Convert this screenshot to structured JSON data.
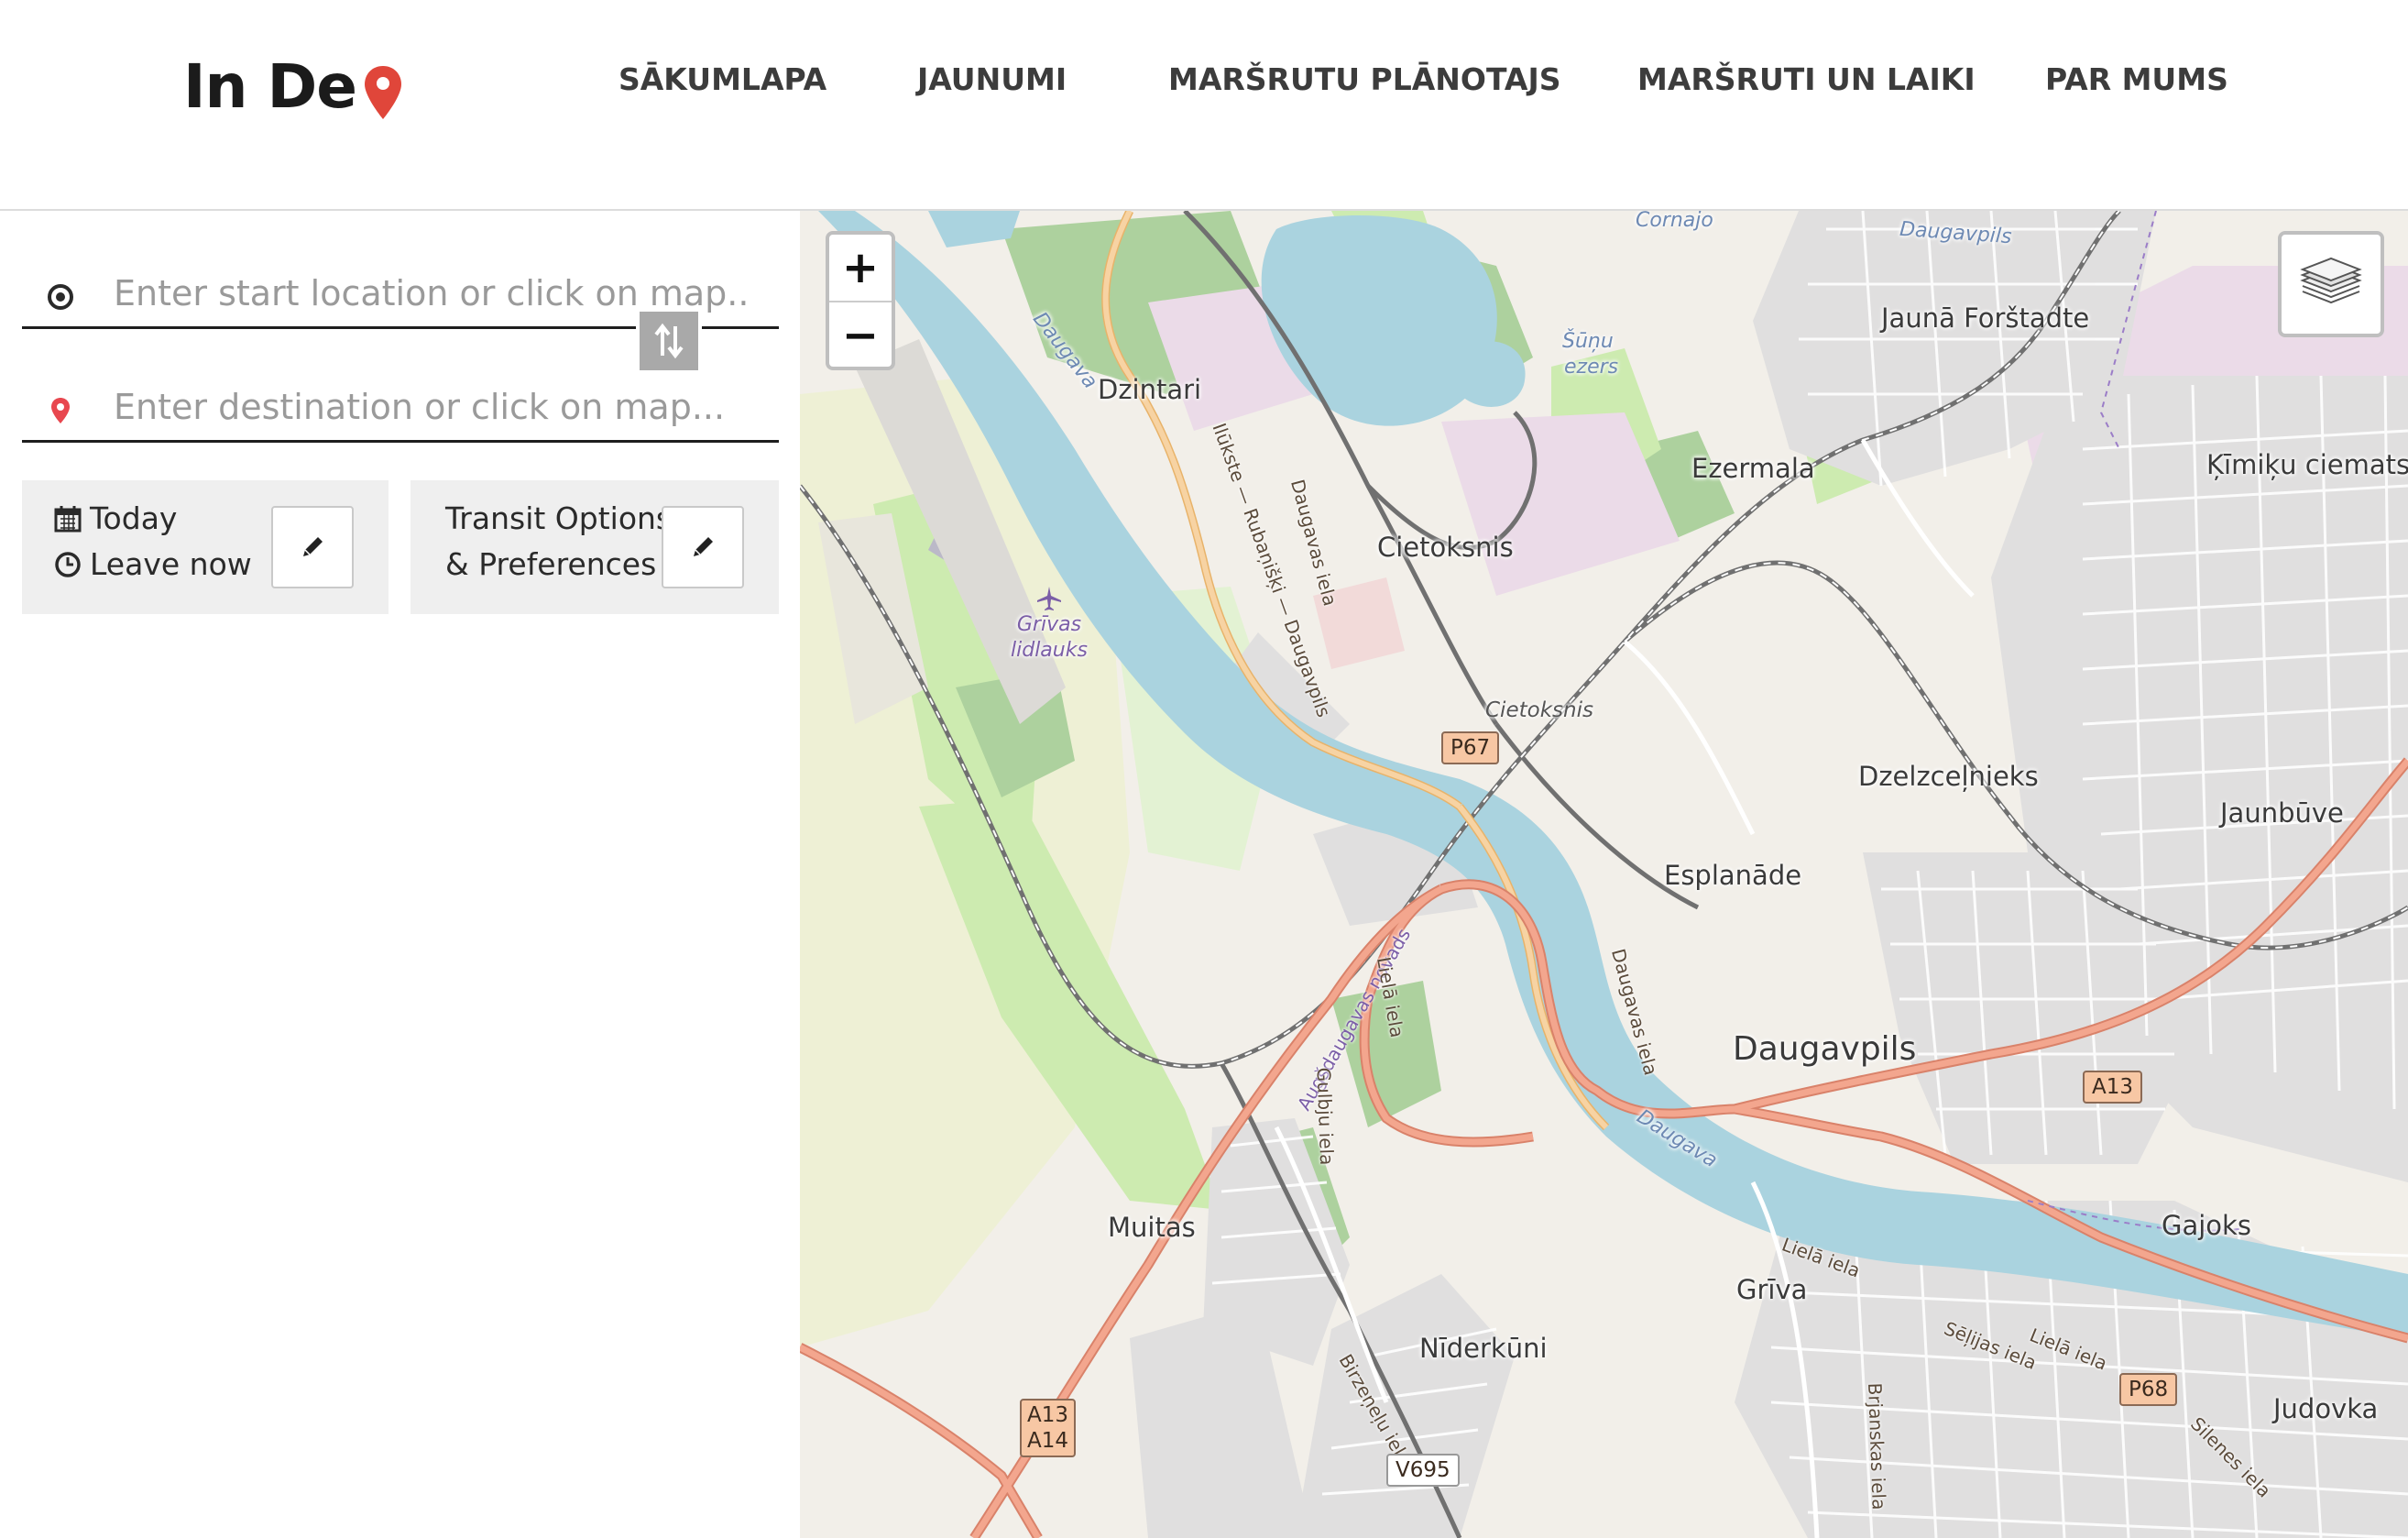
{
  "header": {
    "logo_text": "In De",
    "nav": [
      "SĀKUMLAPA",
      "JAUNUMI",
      "MARŠRUTU PLĀNOTAJS",
      "MARŠRUTI UN LAIKI",
      "PAR MUMS"
    ]
  },
  "planner": {
    "start_placeholder": "Enter start location or click on map...",
    "destination_placeholder": "Enter destination or click on map...",
    "date_label": "Today",
    "time_label": "Leave now",
    "transit_line1": "Transit Options",
    "transit_line2": "& Preferences"
  },
  "map": {
    "zoom_in": "+",
    "zoom_out": "−",
    "labels": {
      "dzintari": "Dzintari",
      "ezermala": "Ezermala",
      "cietoksnis": "Cietoksnis",
      "cietoksnis_small": "Cietoksnis",
      "jauna_forstadte": "Jaunā Forštadte",
      "kimiku": "Ķīmiķu ciemats",
      "dzelzcelnieks": "Dzelzceļnieks",
      "jaunbuve": "Jaunbūve",
      "esplanade": "Esplanāde",
      "daugavpils": "Daugavpils",
      "gajoks": "Gajoks",
      "griva": "Grīva",
      "muitas": "Muitas",
      "niderkuni": "Nīderkūni",
      "judovka": "Judovka",
      "daugavpils_top": "Daugavpils",
      "sunu_ezers_1": "Šūņu",
      "sunu_ezers_2": "ezers",
      "cornajo": "Čornajo",
      "daugava_1": "Daugava",
      "daugava_2": "Daugava",
      "grivas_lidlauks_1": "Grīvas",
      "grivas_lidlauks_2": "lidlauks",
      "daugavas_iela_1": "Daugavas iela",
      "daugavas_iela_2": "Daugavas iela",
      "augsdaugavas": "Augšdaugavas novads",
      "liela_iela_1": "Lielā iela",
      "liela_iela_2": "Lielā iela",
      "liela_iela_3": "Lielā iela",
      "gulbju_iela": "Gulbju iela",
      "seljas_iela": "Sēļijas iela",
      "birzenelu_iela": "Birzeņeļu iela",
      "brianskas_iela": "Brjanskas iela",
      "silenes_iela": "Silenes iela",
      "ilukste_rubanisski": "Ilūkste — Rubaņišķi — Daugavpils"
    },
    "shields": {
      "p67": "P67",
      "a13_right": "A13",
      "p68": "P68",
      "a13_left": "A13",
      "a14_left": "A14",
      "v695": "V695"
    },
    "colors": {
      "water": "#aad3df",
      "land": "#f2efe9",
      "park": "#cdebb0",
      "forest": "#add19e",
      "residential": "#e0dfdf",
      "industrial": "#ebdbe8",
      "primary_road": "#f3a68e",
      "secondary_road": "#f7d3a3",
      "railway": "#707070"
    }
  }
}
